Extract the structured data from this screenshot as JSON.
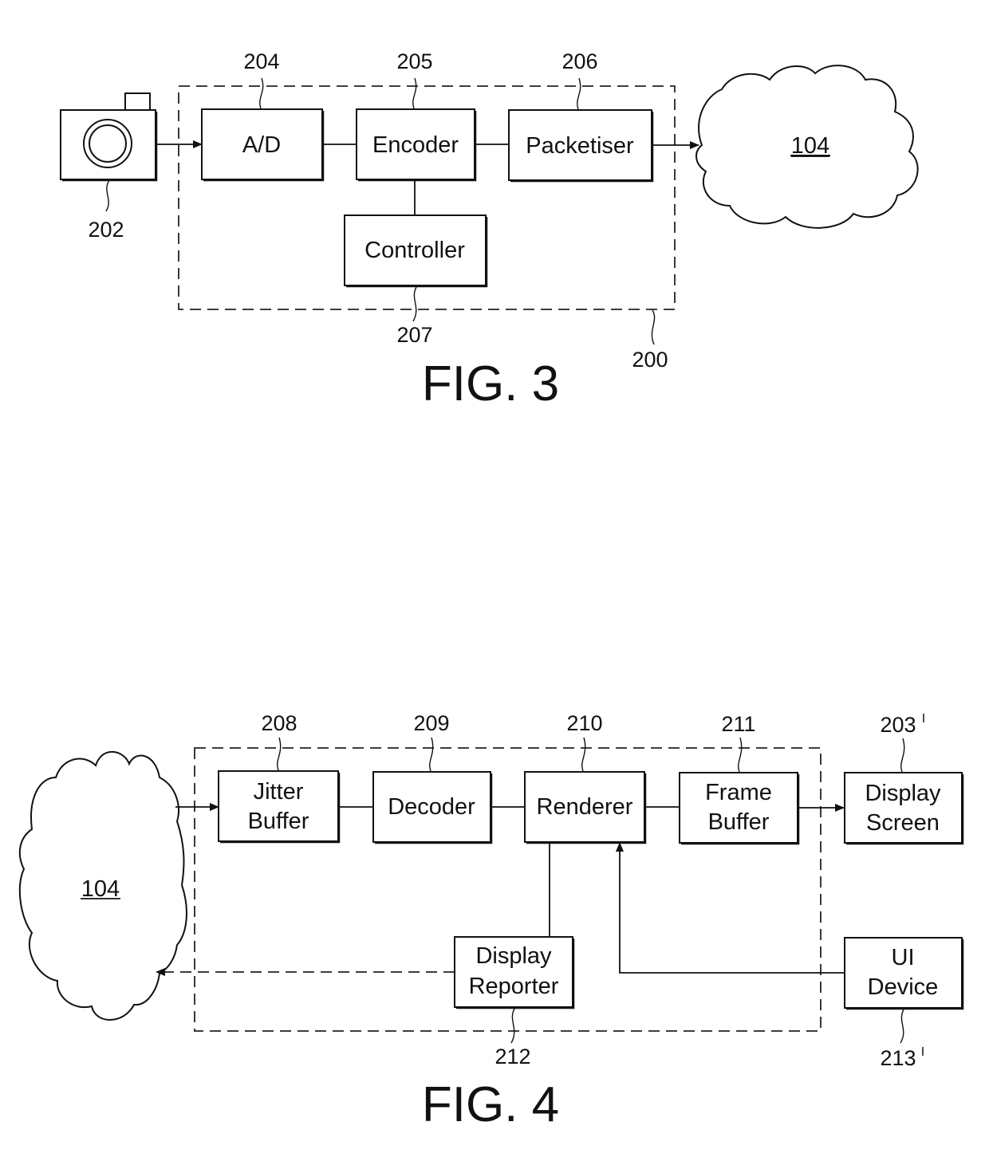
{
  "fig3": {
    "caption": "FIG. 3",
    "camera": {
      "ref": "202"
    },
    "system": {
      "ref": "200"
    },
    "blocks": [
      {
        "id": "ad",
        "label": "A/D",
        "ref": "204"
      },
      {
        "id": "encoder",
        "label": "Encoder",
        "ref": "205"
      },
      {
        "id": "packetiser",
        "label": "Packetiser",
        "ref": "206"
      },
      {
        "id": "controller",
        "label": "Controller",
        "ref": "207"
      }
    ],
    "network": {
      "label": "104"
    }
  },
  "fig4": {
    "caption": "FIG. 4",
    "network": {
      "label": "104"
    },
    "blocks": [
      {
        "id": "jitter",
        "line1": "Jitter",
        "line2": "Buffer",
        "ref": "208"
      },
      {
        "id": "decoder",
        "line1": "Decoder",
        "line2": "",
        "ref": "209"
      },
      {
        "id": "renderer",
        "line1": "Renderer",
        "line2": "",
        "ref": "210"
      },
      {
        "id": "framebuffer",
        "line1": "Frame",
        "line2": "Buffer",
        "ref": "211"
      },
      {
        "id": "displayscreen",
        "line1": "Display",
        "line2": "Screen",
        "ref": "203",
        "prime": "I"
      },
      {
        "id": "reporter",
        "line1": "Display",
        "line2": "Reporter",
        "ref": "212"
      },
      {
        "id": "uidevice",
        "line1": "UI",
        "line2": "Device",
        "ref": "213",
        "prime": "I"
      }
    ]
  }
}
